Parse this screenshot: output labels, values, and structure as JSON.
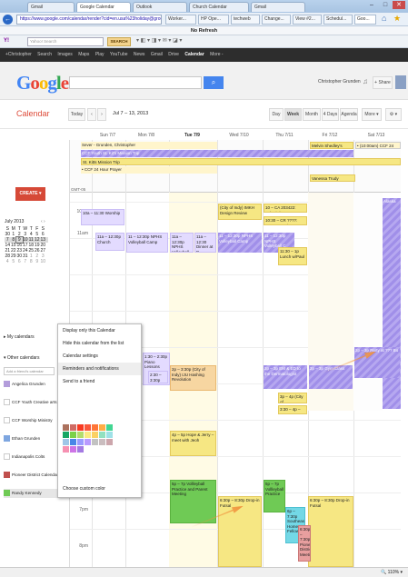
{
  "browser": {
    "tabs": [
      "Gmail",
      "Google Calendar",
      "Outlook",
      "Church Calendar",
      "Gmail"
    ],
    "url": "https://www.google.com/calendar/render?cid=en.usa%23holiday@group.v.calendar.goo",
    "bookmark_tabs": [
      "Worker...",
      "HP Ope...",
      "techweb",
      "Change...",
      "View #2...",
      "Schedul...",
      "Goo..."
    ],
    "command_label": "No Refresh",
    "search_placeholder": "Yahoo! Search",
    "search_button": "SEARCH"
  },
  "gbar": {
    "items": [
      "+Christopher",
      "Search",
      "Images",
      "Maps",
      "Play",
      "YouTube",
      "News",
      "Gmail",
      "Drive"
    ],
    "active": "Calendar",
    "more": "More -"
  },
  "header": {
    "logo": "Google",
    "search_icon": "🔍",
    "user": "Christopher Grunden",
    "share": "+ Share"
  },
  "toolbar": {
    "title": "Calendar",
    "today": "Today",
    "prev": "‹",
    "next": "›",
    "range": "Jul 7 – 13, 2013",
    "views": [
      "Day",
      "Week",
      "Month",
      "4 Days",
      "Agenda"
    ],
    "active_view": "Week",
    "more": "More ▾",
    "settings": "⚙ ▾"
  },
  "sidebar": {
    "create": "CREATE ▾",
    "month": "July 2013",
    "weekdays": [
      "S",
      "M",
      "T",
      "W",
      "T",
      "F",
      "S"
    ],
    "weeks": [
      [
        "30",
        "1",
        "2",
        "3",
        "4",
        "5",
        "6"
      ],
      [
        "7",
        "8",
        "9",
        "10",
        "11",
        "12",
        "13"
      ],
      [
        "14",
        "15",
        "16",
        "17",
        "18",
        "19",
        "20"
      ],
      [
        "21",
        "22",
        "23",
        "24",
        "25",
        "26",
        "27"
      ],
      [
        "28",
        "29",
        "30",
        "31",
        "1",
        "2",
        "3"
      ],
      [
        "4",
        "5",
        "6",
        "7",
        "8",
        "9",
        "10"
      ]
    ],
    "my_calendars": "▸ My calendars",
    "other_calendars": "▾ Other calendars",
    "add_friend": "Add a friend's calendar",
    "calendars": [
      {
        "name": "Angelica Grunden",
        "color": "#b39ddb"
      },
      {
        "name": "CCF Youth Creative arts",
        "color": "#ffffff"
      },
      {
        "name": "CCF Worship Ministry",
        "color": "#ffffff"
      },
      {
        "name": "Ethan Grunden",
        "color": "#7ea6e0"
      },
      {
        "name": "Indianapolis Colts",
        "color": "#ffffff"
      },
      {
        "name": "Pioneer District Calendar",
        "color": "#c0504d"
      },
      {
        "name": "Randy Kennedy",
        "color": "#6fca55"
      }
    ]
  },
  "days": [
    "Sun 7/7",
    "Mon 7/8",
    "Tue 7/9",
    "Wed 7/10",
    "Thu 7/11",
    "Fri 7/12",
    "Sat 7/13"
  ],
  "gmt": "GMT-05",
  "times": [
    "10am",
    "11am",
    "12pm",
    "1pm",
    "2pm",
    "3pm",
    "4pm",
    "5pm",
    "6pm",
    "7pm",
    "8pm"
  ],
  "allday": {
    "e1": "Sever - Grunden, Christopher",
    "e2": "CCF Youth St. Kit's Mission Trip",
    "e3": "St. Kitts Mission Trip",
    "e4": "• CCF 24 Hour Prayer",
    "e5": "Melvin Shedley's birthday",
    "e6": "• (10:00am) CCF 24 Hour F",
    "e7": "Vanessa Trudy Brown's birt"
  },
  "events": {
    "sun10": "10a – 11:30 Worship",
    "sun11": "11a – 12:30p Church",
    "mon11": "11 – 12:30p NPHS Volleyball Camp",
    "tue11": "11a – 12:30p NPHS Volleyball Camp",
    "tue_dinner": "11a – 12:30 Dinner at P",
    "wed10": "(City of Indy) IMKH Design Review",
    "wed11": "11 – 12:30p NPHS Volleyball Camp",
    "thu10a": "10 – CA 203422: IndyBird DN",
    "thu10b": "10:30 – CR ????: Documentatio",
    "thu11": "11 – 12:30p NPHS Volleyball C",
    "thu_lunch": "11:30 – 1p Lunch w/Paul",
    "sat_alaska": "Alaska",
    "tue2": "1:30 – 2:30p Piano Lessons",
    "tue_city": "2:30 – 3:30p (City of Indy)",
    "wed_rev": "2p – 3:30p (City of Indy) IJU Hashing Revolution",
    "thu_em": "2p – 3p EM & ED to the Dermatologist",
    "fri_gym": "2p – 3p Gym Class",
    "sat_party": "2p – 3p Party at ??? Bo",
    "thu_city": "3p – 4p (City of",
    "thu_ph": "3:30 – 4p – PH",
    "wed_hope": "4p – 5p Hope & Jerry – meet with Jeoh",
    "wed_vball": "5p – 7p Vollleyball Practice and Parent Meeting",
    "thu_vball": "5p – 7p Vollleyball Practice",
    "thu_drop": "6:30p – 8:30p Drop-in Futsal",
    "fri_drop": "6:30p – 8:30p Drop-in Futsal",
    "thu_sw": "6p – 7:30p Southeast Home Fellowship",
    "fri_pio": "6:30p – 7:30p Pioneer District Meeting/Ins"
  },
  "context_menu": {
    "items": [
      "Display only this Calendar",
      "Hide this calendar from the list",
      "Calendar settings",
      "Reminders and notifications",
      "Send to a friend"
    ],
    "highlighted": "Reminders and notifications",
    "custom_color": "Choose custom color"
  },
  "swatch_colors": [
    "#ac725e",
    "#d06b64",
    "#f83a22",
    "#fa573c",
    "#ff7537",
    "#ffad46",
    "#42d692",
    "#16a765",
    "#7bd148",
    "#b3dc6c",
    "#fbe983",
    "#fad165",
    "#92e1c0",
    "#9fe1e7",
    "#9fc6e7",
    "#4986e7",
    "#9a9cff",
    "#b99aff",
    "#c2c2c2",
    "#cabdbf",
    "#cca6ac",
    "#f691b2",
    "#cd74e6",
    "#a47ae2"
  ],
  "status": "🔍 110% ▾"
}
